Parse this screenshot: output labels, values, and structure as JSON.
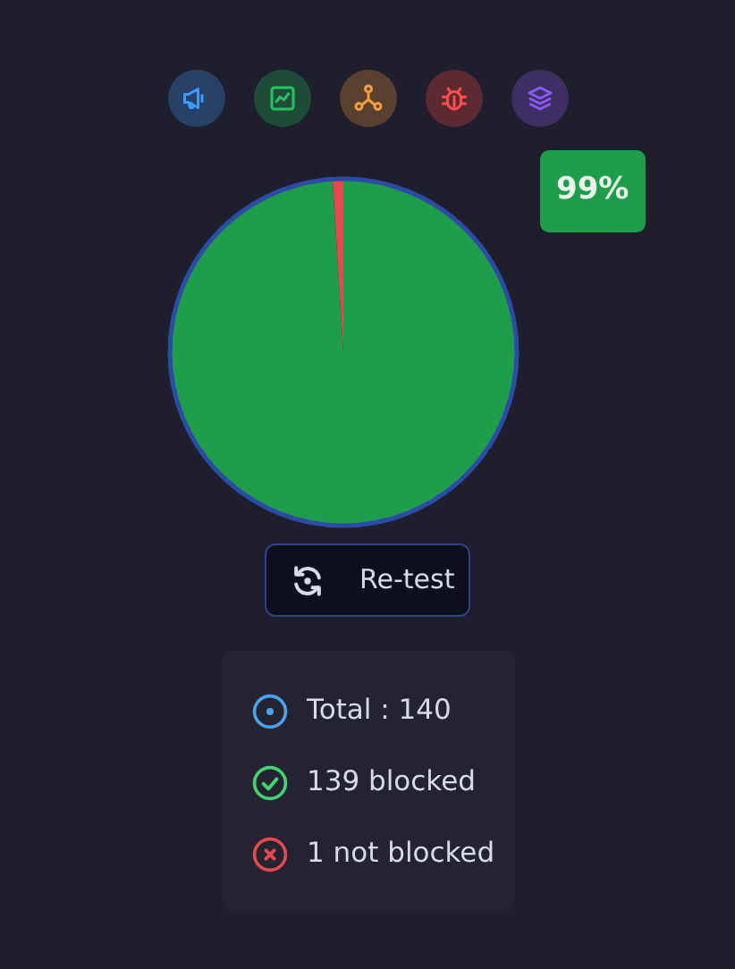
{
  "category_icons": [
    {
      "kind": "megaphone",
      "color": "#3b9cff"
    },
    {
      "kind": "chart",
      "color": "#22c55e"
    },
    {
      "kind": "nodes",
      "color": "#f59e3b"
    },
    {
      "kind": "bug",
      "color": "#ff4d4d"
    },
    {
      "kind": "layers",
      "color": "#8b5cf6"
    }
  ],
  "chart_data": {
    "type": "pie",
    "series": [
      {
        "values": [
          99,
          1
        ]
      }
    ],
    "colors": [
      "#1e9e4a",
      "#e5484d"
    ]
  },
  "percent_label": "99%",
  "retest_button": "Re-test",
  "stats": [
    {
      "kind": "total",
      "text": "Total : 140",
      "color": "#4aa3f0"
    },
    {
      "kind": "ok",
      "text": "139 blocked",
      "color": "#3fd46f"
    },
    {
      "kind": "fail",
      "text": "1 not blocked",
      "color": "#e5484d"
    }
  ]
}
